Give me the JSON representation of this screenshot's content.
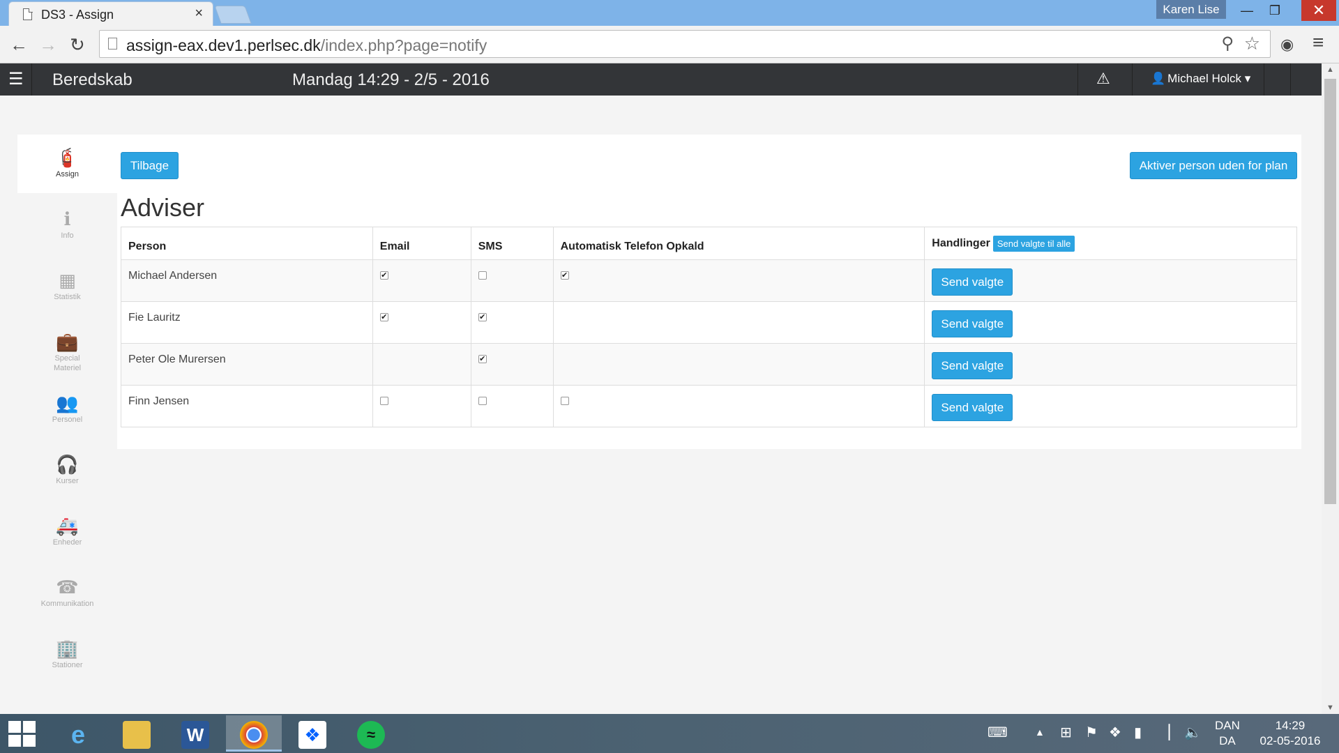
{
  "browser": {
    "tab_title": "DS3 - Assign",
    "tab_close": "×",
    "profile_name": "Karen Lise",
    "url_host": "assign-eax.dev1.perlsec.dk",
    "url_path": "/index.php?page=notify"
  },
  "header": {
    "brand": "Beredskab",
    "datetime": "Mandag 14:29 - 2/5 - 2016",
    "user": "Michael Holck"
  },
  "sidebar": {
    "items": [
      {
        "label": "Assign",
        "icon": "fire-extinguisher-icon",
        "active": true
      },
      {
        "label": "Info",
        "icon": "info-icon"
      },
      {
        "label": "Statistik",
        "icon": "calendar-icon"
      },
      {
        "label": "Special Materiel",
        "icon": "briefcase-icon"
      },
      {
        "label": "Personel",
        "icon": "users-icon"
      },
      {
        "label": "Kurser",
        "icon": "headphones-icon"
      },
      {
        "label": "Enheder",
        "icon": "ambulance-icon"
      },
      {
        "label": "Kommunikation",
        "icon": "phone-icon"
      },
      {
        "label": "Stationer",
        "icon": "building-icon"
      }
    ]
  },
  "main": {
    "back_button": "Tilbage",
    "activate_button": "Aktiver person uden for plan",
    "title": "Adviser",
    "table": {
      "headers": {
        "person": "Person",
        "email": "Email",
        "sms": "SMS",
        "phone": "Automatisk Telefon Opkald",
        "actions": "Handlinger",
        "send_all": "Send valgte til alle"
      },
      "send_label": "Send valgte",
      "rows": [
        {
          "person": "Michael Andersen",
          "email": true,
          "sms": false,
          "phone": true
        },
        {
          "person": "Fie Lauritz",
          "email": true,
          "sms": true,
          "phone": null
        },
        {
          "person": "Peter Ole Murersen",
          "email": null,
          "sms": true,
          "phone": null
        },
        {
          "person": "Finn Jensen",
          "email": false,
          "sms": false,
          "phone": false
        }
      ]
    }
  },
  "taskbar": {
    "lang_top": "DAN",
    "lang_bottom": "DA",
    "time": "14:29",
    "date": "02-05-2016"
  }
}
